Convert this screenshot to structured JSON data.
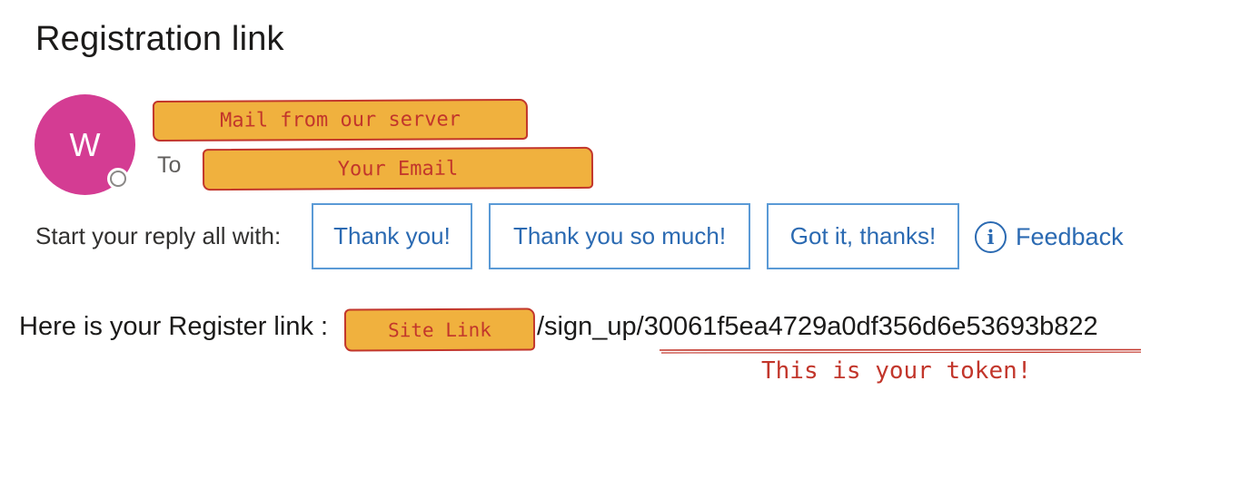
{
  "email": {
    "title": "Registration link",
    "sender_initial": "W",
    "from_annotation": "Mail from our server",
    "to_label": "To",
    "to_annotation": "Your Email"
  },
  "quick_reply": {
    "label": "Start your reply all with:",
    "options": [
      "Thank you!",
      "Thank you so much!",
      "Got it, thanks!"
    ],
    "feedback_label": "Feedback",
    "feedback_icon": "info-icon"
  },
  "message": {
    "label": "Here is your Register link :",
    "site_annotation": "Site Link",
    "path": "/sign_up/30061f5ea4729a0df356d6e53693b822",
    "token_note": "This is your token!"
  },
  "colors": {
    "avatar": "#d43c93",
    "annotation_fill": "#f0b13e",
    "annotation_ink": "#c2362b",
    "link_blue": "#2b6ab2"
  }
}
